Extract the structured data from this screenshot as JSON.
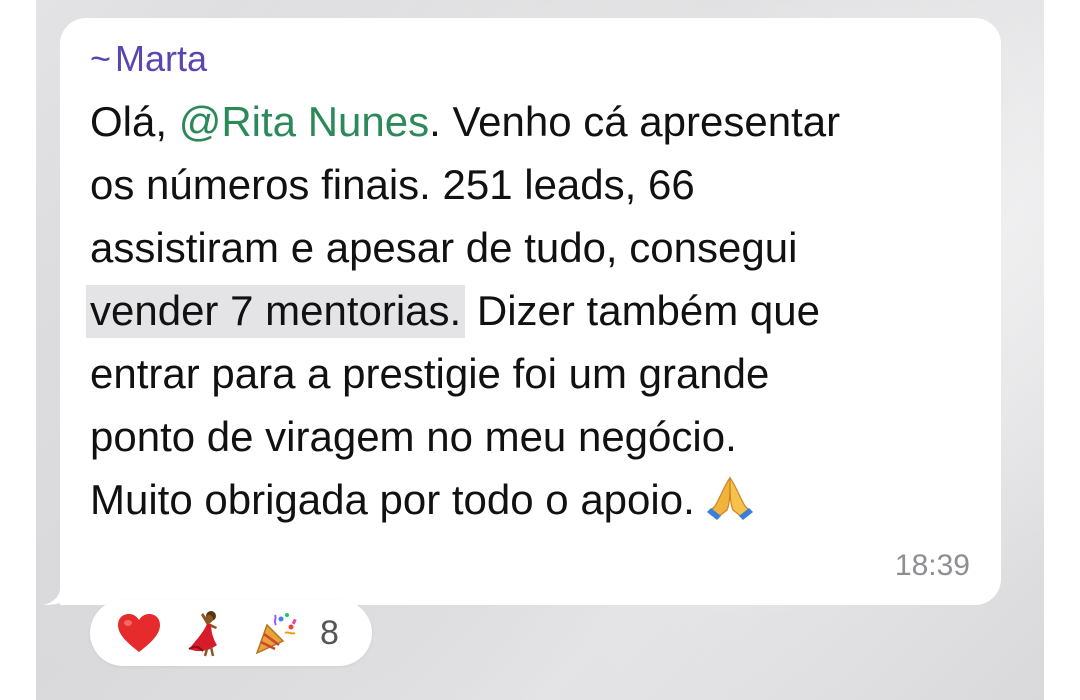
{
  "message": {
    "sender_prefix": "~",
    "sender_name": "Marta",
    "greeting": "Olá, ",
    "mention": "@Rita Nunes",
    "line1_rest": ". Venho cá apresentar",
    "line2": "os números finais. 251 leads, 66",
    "line3": "assistiram e apesar de tudo, consegui",
    "line4_highlight": "vender 7 mentorias.",
    "line4_rest": " Dizer também que",
    "line5": "entrar para a prestigie foi um grande",
    "line6": "ponto de viragem no meu negócio.",
    "line7": "Muito obrigada por todo o apoio.",
    "trailing_emoji": "folded-hands-icon",
    "time": "18:39"
  },
  "reactions": {
    "items": [
      {
        "icon": "red-heart-icon"
      },
      {
        "icon": "dancer-icon"
      },
      {
        "icon": "party-popper-icon"
      }
    ],
    "count": "8"
  },
  "colors": {
    "sender": "#5b46b0",
    "mention": "#2c8a5a",
    "highlight": "#e4e4e6",
    "timestamp": "#8e8e93"
  }
}
